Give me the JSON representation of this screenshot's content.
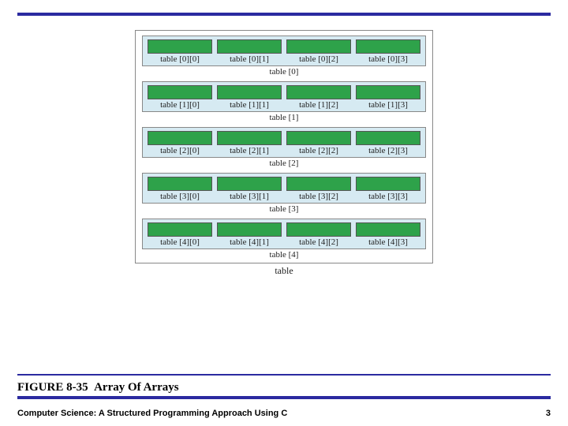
{
  "diagram": {
    "outer_label": "table",
    "rows": [
      {
        "label": "table [0]",
        "cells": [
          "table [0][0]",
          "table [0][1]",
          "table [0][2]",
          "table [0][3]"
        ]
      },
      {
        "label": "table [1]",
        "cells": [
          "table [1][0]",
          "table [1][1]",
          "table [1][2]",
          "table [1][3]"
        ]
      },
      {
        "label": "table [2]",
        "cells": [
          "table [2][0]",
          "table [2][1]",
          "table [2][2]",
          "table [2][3]"
        ]
      },
      {
        "label": "table [3]",
        "cells": [
          "table [3][0]",
          "table [3][1]",
          "table [3][2]",
          "table [3][3]"
        ]
      },
      {
        "label": "table [4]",
        "cells": [
          "table [4][0]",
          "table [4][1]",
          "table [4][2]",
          "table [4][3]"
        ]
      }
    ]
  },
  "caption": {
    "number": "FIGURE 8-35",
    "title": "Array Of Arrays"
  },
  "footer": {
    "book": "Computer Science: A Structured Programming Approach Using C",
    "page": "3"
  }
}
